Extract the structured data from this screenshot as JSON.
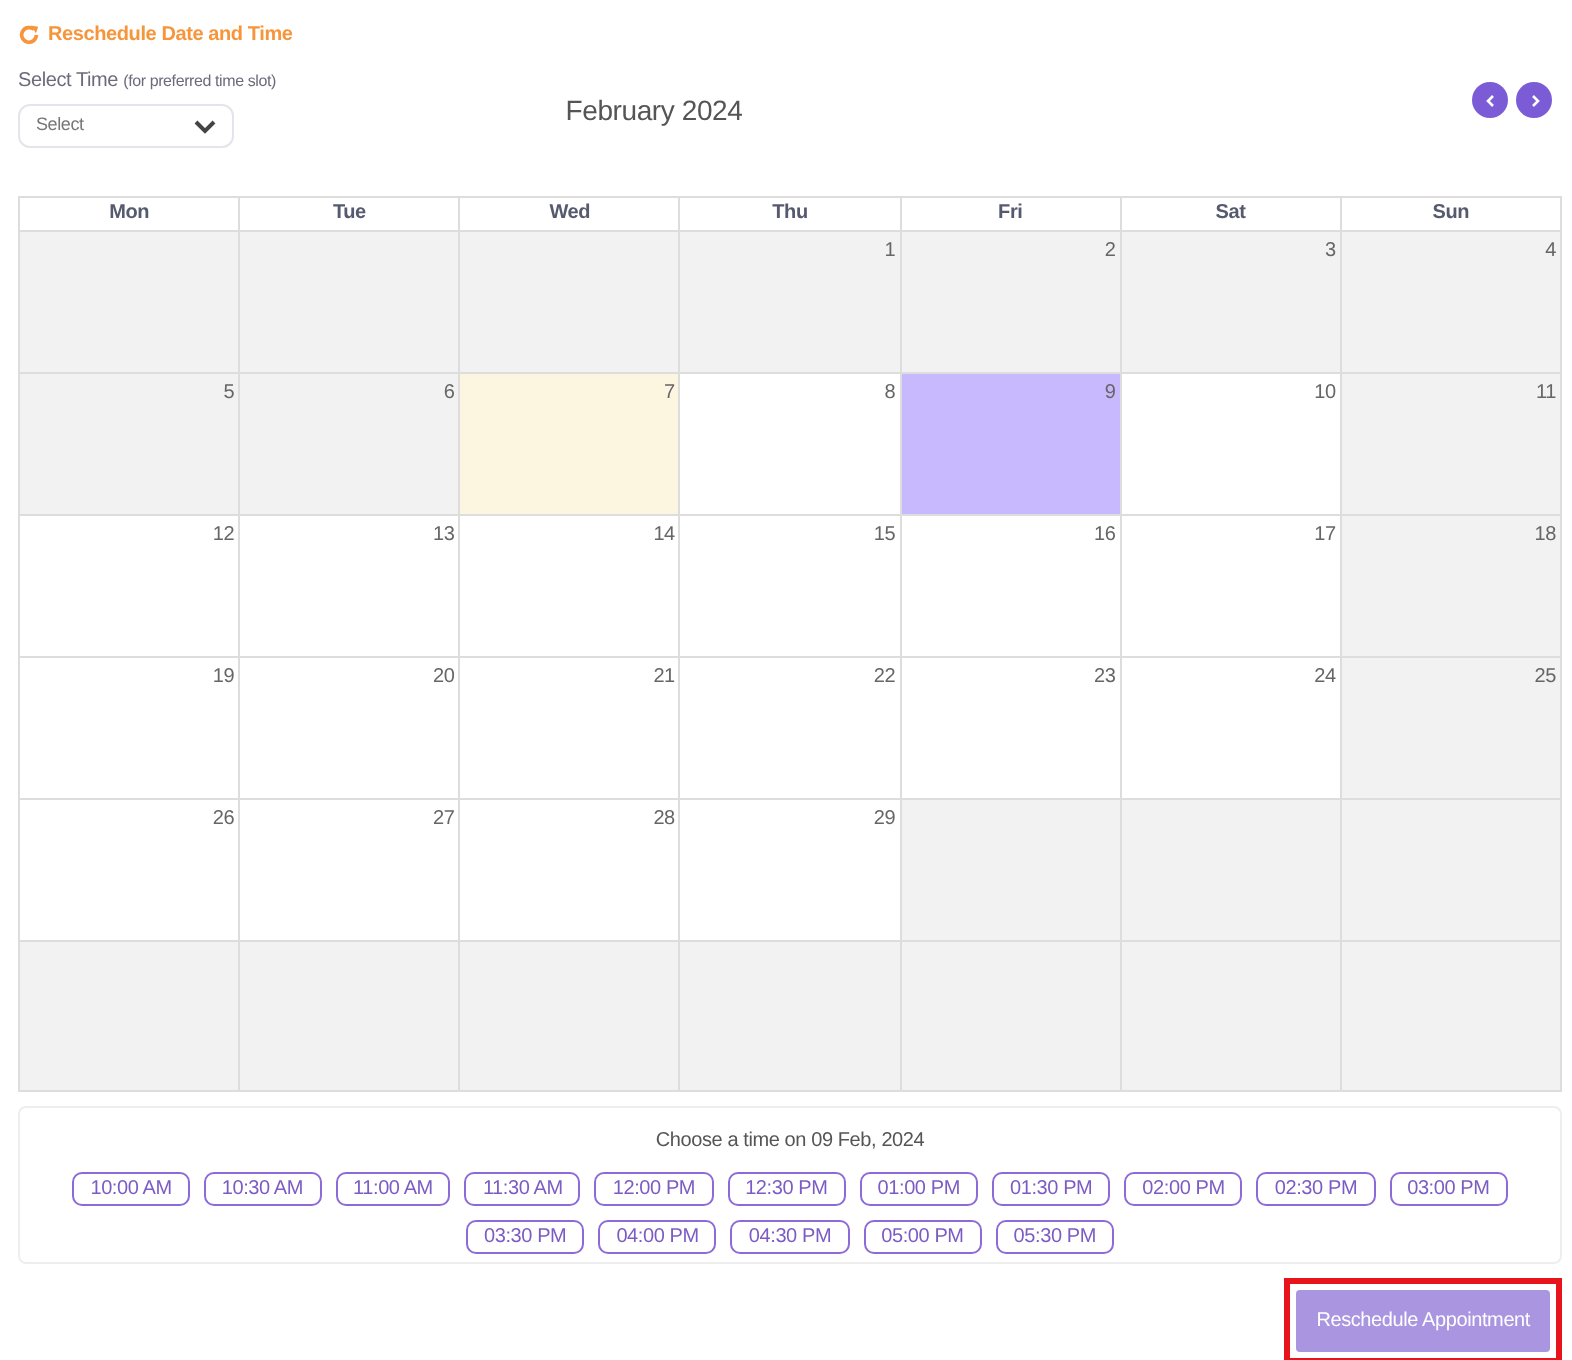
{
  "header": {
    "title": "Reschedule Date and Time"
  },
  "time_select": {
    "label": "Select Time",
    "hint": "(for preferred time slot)",
    "placeholder": "Select"
  },
  "calendar": {
    "month": "February 2024",
    "weekdays": [
      "Mon",
      "Tue",
      "Wed",
      "Thu",
      "Fri",
      "Sat",
      "Sun"
    ],
    "weeks": [
      [
        {
          "color": "#f2f2f2"
        },
        {
          "color": "#f2f2f2"
        },
        {
          "color": "#f2f2f2"
        },
        {
          "day": "1",
          "color": "#f2f2f2"
        },
        {
          "day": "2",
          "color": "#f2f2f2"
        },
        {
          "day": "3",
          "color": "#f2f2f2"
        },
        {
          "day": "4",
          "color": "#f2f2f2"
        }
      ],
      [
        {
          "day": "5",
          "color": "#f2f2f2"
        },
        {
          "day": "6",
          "color": "#f2f2f2"
        },
        {
          "day": "7",
          "color": "#fcf6e1"
        },
        {
          "day": "8",
          "color": "#ffffff"
        },
        {
          "day": "9",
          "color": "#c8b8fd"
        },
        {
          "day": "10",
          "color": "#ffffff"
        },
        {
          "day": "11",
          "color": "#f2f2f2"
        }
      ],
      [
        {
          "day": "12",
          "color": "#ffffff"
        },
        {
          "day": "13",
          "color": "#ffffff"
        },
        {
          "day": "14",
          "color": "#ffffff"
        },
        {
          "day": "15",
          "color": "#ffffff"
        },
        {
          "day": "16",
          "color": "#ffffff"
        },
        {
          "day": "17",
          "color": "#ffffff"
        },
        {
          "day": "18",
          "color": "#f2f2f2"
        }
      ],
      [
        {
          "day": "19",
          "color": "#ffffff"
        },
        {
          "day": "20",
          "color": "#ffffff"
        },
        {
          "day": "21",
          "color": "#ffffff"
        },
        {
          "day": "22",
          "color": "#ffffff"
        },
        {
          "day": "23",
          "color": "#ffffff"
        },
        {
          "day": "24",
          "color": "#ffffff"
        },
        {
          "day": "25",
          "color": "#f2f2f2"
        }
      ],
      [
        {
          "day": "26",
          "color": "#ffffff"
        },
        {
          "day": "27",
          "color": "#ffffff"
        },
        {
          "day": "28",
          "color": "#ffffff"
        },
        {
          "day": "29",
          "color": "#ffffff"
        },
        {
          "color": "#f2f2f2"
        },
        {
          "color": "#f2f2f2"
        },
        {
          "color": "#f2f2f2"
        }
      ],
      [
        {
          "color": "#f2f2f2"
        },
        {
          "color": "#f2f2f2"
        },
        {
          "color": "#f2f2f2"
        },
        {
          "color": "#f2f2f2"
        },
        {
          "color": "#f2f2f2"
        },
        {
          "color": "#f2f2f2"
        },
        {
          "color": "#f2f2f2"
        }
      ]
    ]
  },
  "time_slots": {
    "heading": "Choose a time on 09 Feb, 2024",
    "slots": [
      {
        "label": "10:00 AM",
        "selected": false
      },
      {
        "label": "10:30 AM",
        "selected": false
      },
      {
        "label": "11:00 AM",
        "selected": false
      },
      {
        "label": "11:30 AM",
        "selected": false
      },
      {
        "label": "12:00 PM",
        "selected": false
      },
      {
        "label": "12:30 PM",
        "selected": false
      },
      {
        "label": "01:00 PM",
        "selected": false
      },
      {
        "label": "01:30 PM",
        "selected": false
      },
      {
        "label": "02:00 PM",
        "selected": false
      },
      {
        "label": "02:30 PM",
        "selected": false
      },
      {
        "label": "03:00 PM",
        "selected": false
      },
      {
        "label": "03:30 PM",
        "selected": false
      },
      {
        "label": "04:00 PM",
        "selected": false
      },
      {
        "label": "04:30 PM",
        "selected": false
      },
      {
        "label": "05:00 PM",
        "selected": false
      },
      {
        "label": "05:30 PM",
        "selected": false
      }
    ]
  },
  "submit": {
    "label": "Reschedule Appointment",
    "disabled": true,
    "highlighted": true
  }
}
